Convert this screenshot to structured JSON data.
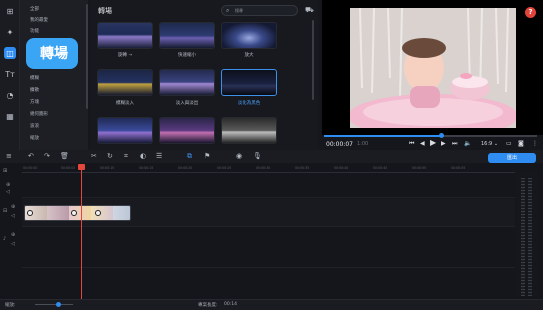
{
  "rail": {
    "items": [
      {
        "icon": "import-icon",
        "glyph": "⊞"
      },
      {
        "icon": "magic-wand-icon",
        "glyph": "✦"
      },
      {
        "icon": "transitions-icon",
        "glyph": "◫"
      },
      {
        "icon": "titles-icon",
        "glyph": "Tт"
      },
      {
        "icon": "stickers-icon",
        "glyph": "◔"
      },
      {
        "icon": "more-tools-icon",
        "glyph": "▦"
      }
    ]
  },
  "categories": [
    "全部",
    "我的最愛",
    "功能",
    "",
    "",
    "",
    "模糊",
    "擴散",
    "方塊",
    "幾何圖形",
    "波浪",
    "縮放"
  ],
  "callout": {
    "label": "轉場"
  },
  "panel": {
    "title": "轉場",
    "search_placeholder": "搜尋",
    "thumbs": [
      {
        "caption": "旋轉 ⇢",
        "selected": false
      },
      {
        "caption": "快速縮小",
        "selected": false
      },
      {
        "caption": "放大",
        "selected": false
      },
      {
        "caption": "模糊淡入",
        "selected": false
      },
      {
        "caption": "淡入與淡出",
        "selected": false
      },
      {
        "caption": "淡化為黑色",
        "selected": true
      },
      {
        "caption": "",
        "selected": false
      },
      {
        "caption": "",
        "selected": false
      },
      {
        "caption": "",
        "selected": false
      }
    ]
  },
  "player": {
    "timecode": "00:00:07",
    "timecode_total": "1:00",
    "progress": 0.55,
    "aspect": "16:9 ⌄"
  },
  "toolbar": {
    "export_label": "匯出"
  },
  "timeline": {
    "ticks": [
      "00:00:00",
      "00:00:05",
      "00:00:10",
      "00:00:15",
      "00:00:20",
      "00:00:25",
      "00:00:30",
      "00:00:35",
      "00:00:40",
      "00:00:45",
      "00:00:50",
      "00:00:55"
    ]
  },
  "status": {
    "scale_label": "縮放:",
    "zoom": 0.6,
    "duration_label": "專案長度:",
    "duration_value": "00:14"
  },
  "colors": {
    "accent": "#2f8cf0",
    "callout": "#3aa4f5",
    "playhead": "#e3473c",
    "selected_caption": "#4aa2ff"
  }
}
